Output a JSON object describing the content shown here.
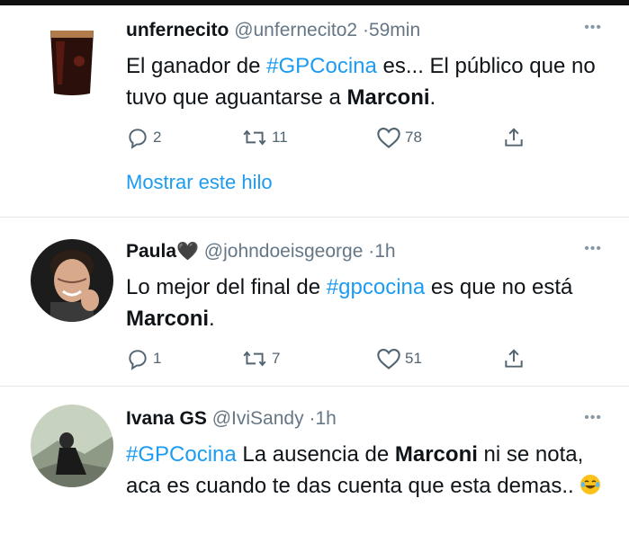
{
  "tweets": [
    {
      "name": "unfernecito",
      "handle": "@unfernecito2",
      "dot": "·",
      "time": "59min",
      "more": "•••",
      "text": {
        "p1": "El ganador de ",
        "hashtag": "#GPCocina",
        "p2": " es... El público que no tuvo que aguantarse a ",
        "bold": "Marconi",
        "p3": "."
      },
      "replies": "2",
      "retweets": "11",
      "likes": "78",
      "thread_link": "Mostrar este hilo",
      "avatar": "glass-of-drink"
    },
    {
      "name": "Paula",
      "name_suffix": "🖤",
      "handle": "@johndoeisgeorge",
      "dot": "·",
      "time": "1h",
      "more": "•••",
      "text": {
        "p1": "Lo mejor del final de ",
        "hashtag": "#gpcocina",
        "p2": " es que no está ",
        "bold": "Marconi",
        "p3": "."
      },
      "replies": "1",
      "retweets": "7",
      "likes": "51",
      "avatar": "man-smiling-portrait"
    },
    {
      "name": "Ivana GS",
      "handle": "@IviSandy",
      "dot": "·",
      "time": "1h",
      "more": "•••",
      "text": {
        "hashtag": "#GPCocina",
        "p1": " La ausencia de ",
        "bold": "Marconi",
        "p2": " ni se nota, aca es cuando te das cuenta que esta demas.. "
      },
      "emoji": "face-with-tears-of-joy",
      "avatar": "person-on-rocks"
    }
  ],
  "colors": {
    "accent": "#1d9bf0",
    "text": "#0f1419",
    "muted": "#657786",
    "divider": "#e6e9ec"
  },
  "icons": [
    "reply-icon",
    "retweet-icon",
    "like-icon",
    "share-icon",
    "more-icon"
  ]
}
